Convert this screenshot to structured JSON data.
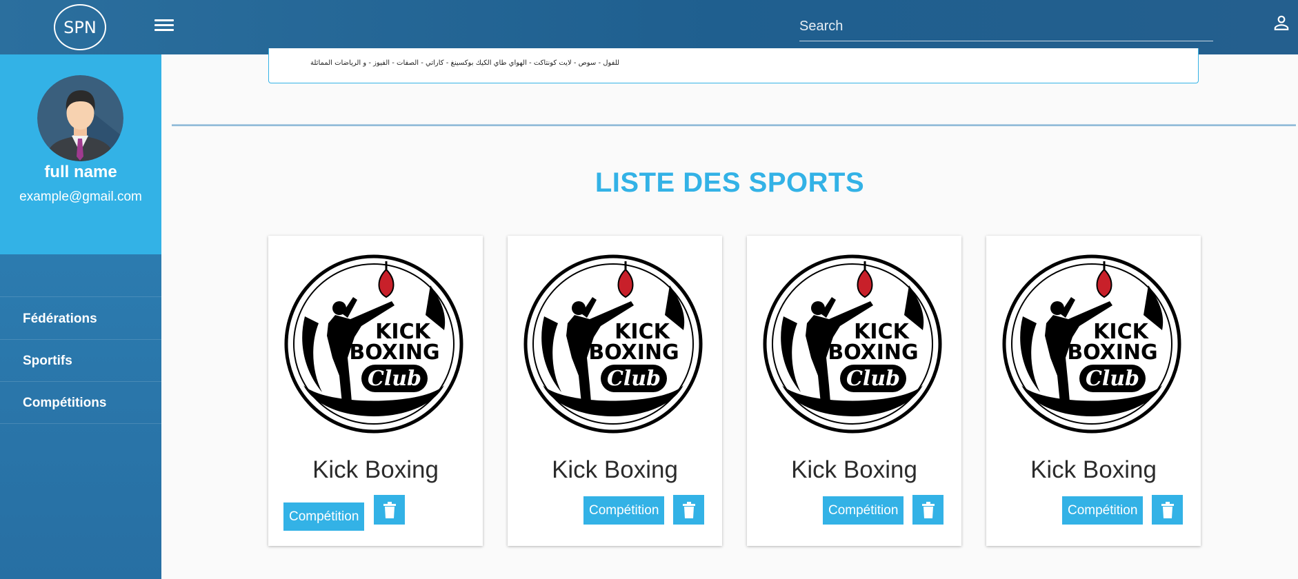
{
  "header": {
    "logo_text": "SPN",
    "search_placeholder": "Search",
    "menu_icon": "hamburger-menu-icon",
    "user_icon": "person-icon"
  },
  "sidebar": {
    "profile": {
      "full_name": "full name",
      "email": "example@gmail.com"
    },
    "items": [
      {
        "label": "Fédérations"
      },
      {
        "label": "Sportifs"
      },
      {
        "label": "Compétitions"
      }
    ]
  },
  "main": {
    "banner_text": "للفول - سوص - لايت كونتاكت - الهواي طاي الكيك بوكسينغ - كاراتي - الصفات - الفيوز - و الرياضات المماثلة",
    "title": "LISTE DES SPORTS",
    "cards": [
      {
        "name": "Kick Boxing",
        "competition_label": "Compétition",
        "logo_text": [
          "KICK",
          "BOXING",
          "Club"
        ]
      },
      {
        "name": "Kick Boxing",
        "competition_label": "Compétition",
        "logo_text": [
          "KICK",
          "BOXING",
          "Club"
        ]
      },
      {
        "name": "Kick Boxing",
        "competition_label": "Compétition",
        "logo_text": [
          "KICK",
          "BOXING",
          "Club"
        ]
      },
      {
        "name": "Kick Boxing",
        "competition_label": "Compétition",
        "logo_text": [
          "KICK",
          "BOXING",
          "Club"
        ]
      }
    ]
  },
  "colors": {
    "accent": "#33b2e6",
    "header": "#245f8e",
    "sidebar": "#2a76aa"
  }
}
